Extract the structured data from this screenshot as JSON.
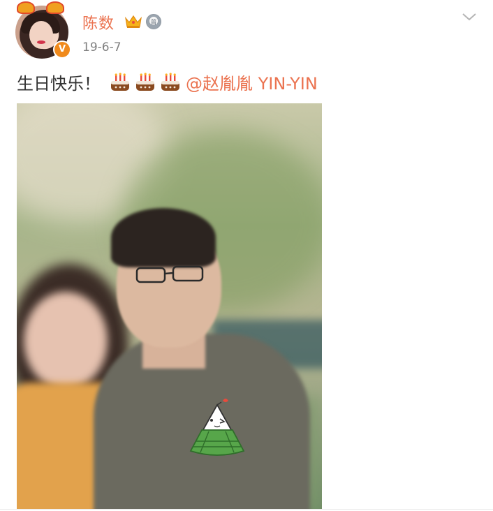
{
  "header": {
    "username": "陈数",
    "verified_badge": "V",
    "timestamp": "19-6-7",
    "badge_icons": [
      "crown-icon",
      "medal-icon"
    ],
    "medal_label": "普"
  },
  "post": {
    "text_prefix": "生日快乐！",
    "cake_icons": [
      "birthday-cake-icon",
      "birthday-cake-icon",
      "birthday-cake-icon"
    ],
    "mention": "@赵胤胤 YIN-YIN"
  },
  "colors": {
    "username": "#eb7350",
    "mention": "#eb7350",
    "timestamp": "#808080",
    "body_text": "#333333",
    "verified_badge": "#f08a1c"
  },
  "image": {
    "description_icon": "photo",
    "sticker": "zongzi-sticker-icon"
  }
}
